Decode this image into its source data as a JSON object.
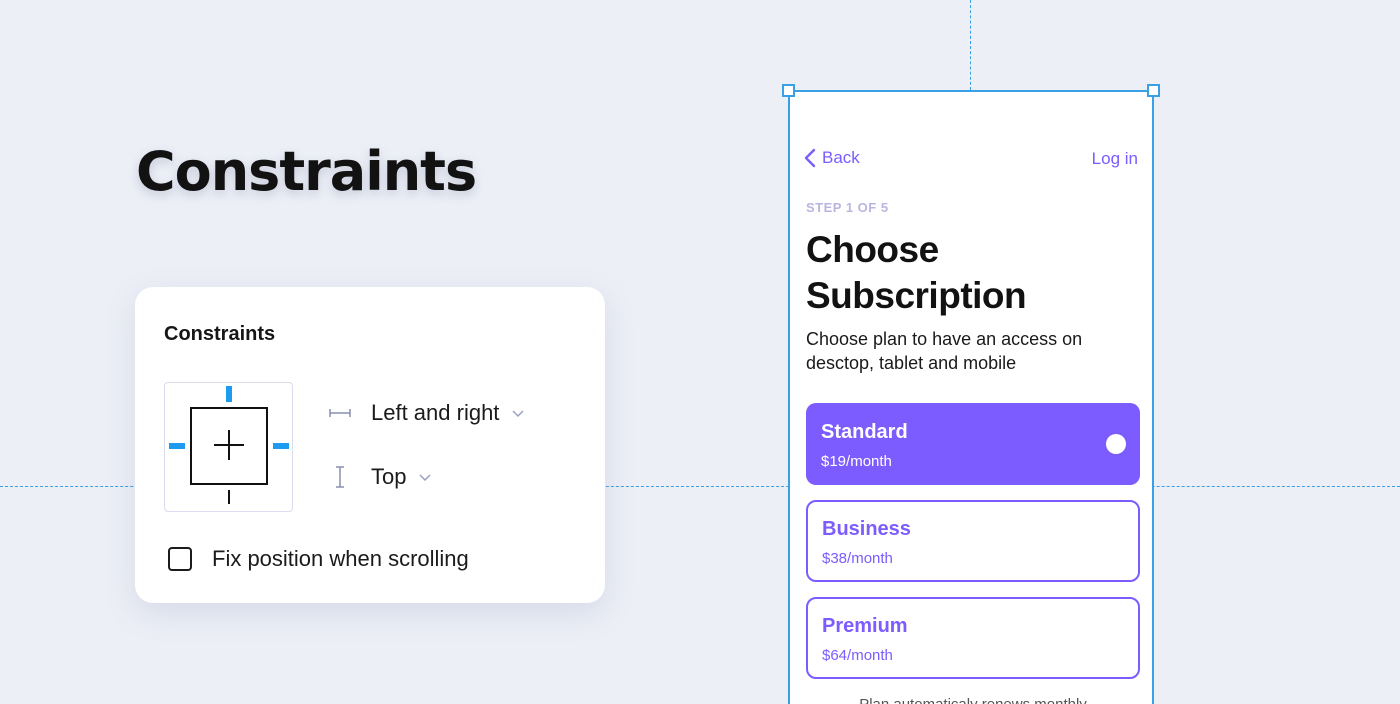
{
  "page": {
    "title": "Constraints"
  },
  "panel": {
    "title": "Constraints",
    "horizontal_constraint": "Left and right",
    "vertical_constraint": "Top",
    "fix_position_label": "Fix position when scrolling",
    "fix_position_checked": false
  },
  "phone": {
    "back_label": "Back",
    "login_label": "Log in",
    "step_label": "STEP 1 OF 5",
    "heading_line1": "Choose",
    "heading_line2": "Subscription",
    "subtext": "Choose plan to have an access on desctop, tablet and mobile",
    "plans": [
      {
        "name": "Standard",
        "price": "$19/month",
        "selected": true
      },
      {
        "name": "Business",
        "price": "$38/month",
        "selected": false
      },
      {
        "name": "Premium",
        "price": "$64/month",
        "selected": false
      }
    ],
    "renew_note": "Plan automaticaly renews monthly"
  },
  "colors": {
    "background": "#eceff6",
    "accent": "#7c5cff",
    "guide": "#3aa0e6",
    "constraint_active": "#1d9bf0"
  },
  "icons": {
    "back": "chevron-left-icon",
    "horizontal": "horizontal-constraint-icon",
    "vertical": "vertical-constraint-icon",
    "dropdown": "chevron-down-icon"
  }
}
